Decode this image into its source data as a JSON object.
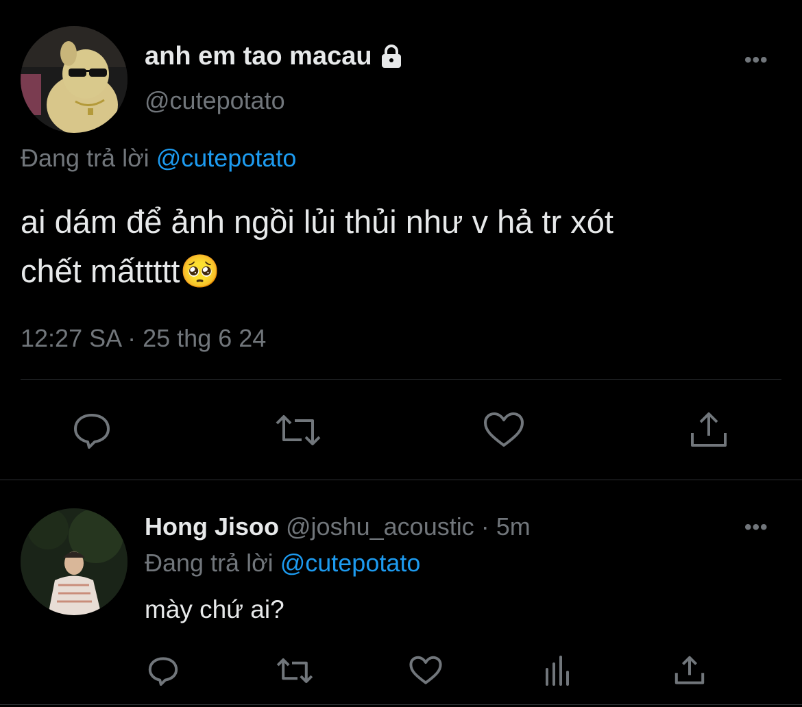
{
  "main_tweet": {
    "display_name": "anh em tao macau",
    "handle": "@cutepotato",
    "replying_prefix": "Đang trả lời",
    "replying_to": "@cutepotato",
    "text_line1": "ai dám để ảnh ngồi lủi thủi như v hả tr xót",
    "text_line2": "chết mấttttt",
    "emoji": "🥺",
    "timestamp": "12:27 SA · 25 thg 6 24",
    "more": "•••"
  },
  "reply": {
    "display_name": "Hong Jisoo",
    "handle_time": "@joshu_acoustic · 5m",
    "replying_prefix": "Đang trả lời",
    "replying_to": "@cutepotato",
    "text": "mày chứ ai?",
    "more": "•••"
  },
  "icons": {
    "lock": "lock-icon",
    "reply": "reply-icon",
    "retweet": "retweet-icon",
    "like": "heart-icon",
    "views": "views-icon",
    "share": "share-icon"
  },
  "colors": {
    "background": "#000000",
    "text": "#e7e9ea",
    "muted": "#71767b",
    "link": "#1d9bf0",
    "divider": "#2f3336"
  }
}
